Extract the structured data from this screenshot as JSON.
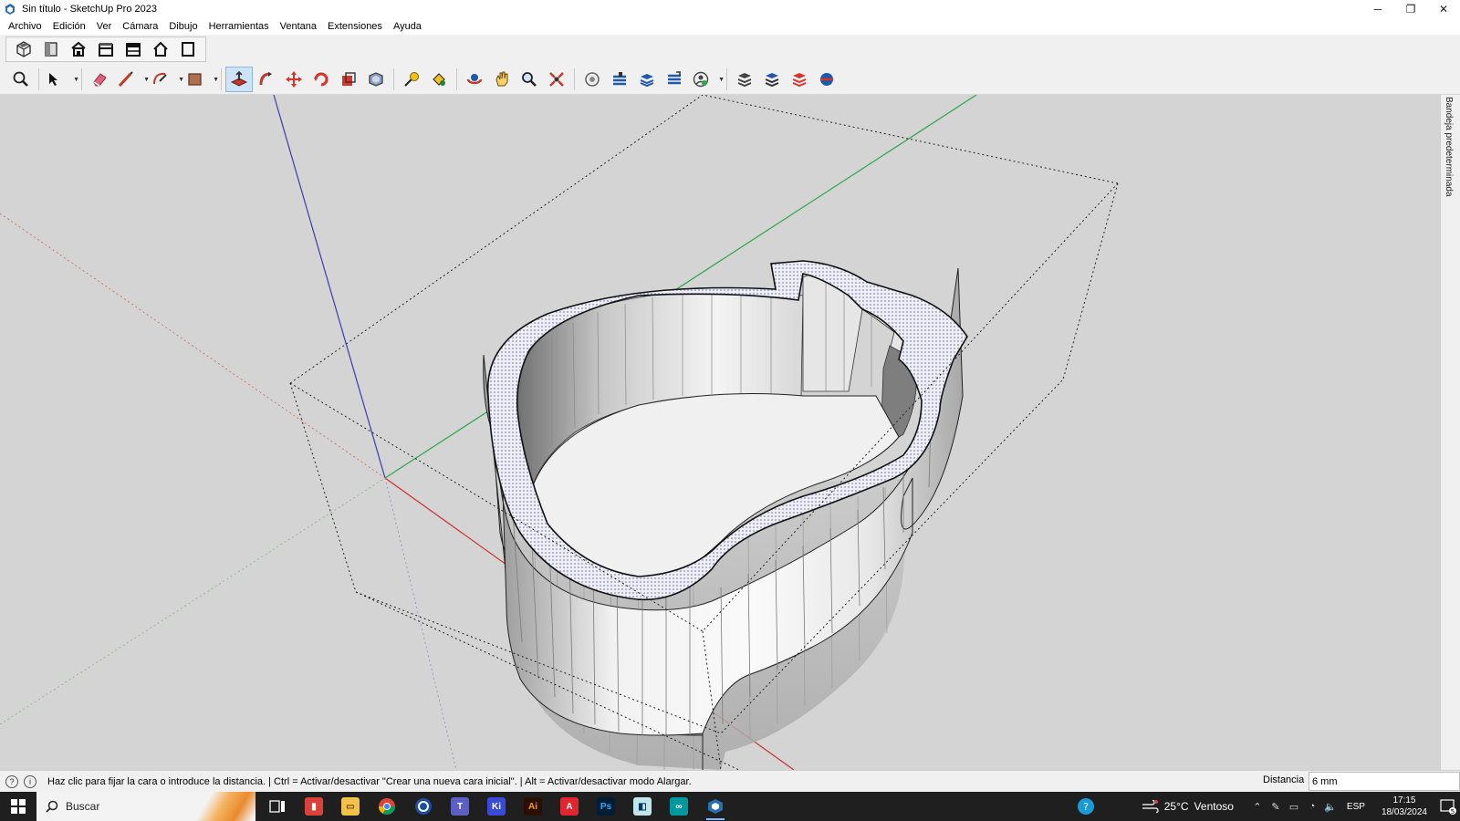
{
  "window": {
    "title": "Sin título - SketchUp Pro 2023",
    "controls": {
      "minimize": "─",
      "restore": "❐",
      "close": "✕"
    }
  },
  "menu": [
    "Archivo",
    "Edición",
    "Ver",
    "Cámara",
    "Dibujo",
    "Herramientas",
    "Ventana",
    "Extensiones",
    "Ayuda"
  ],
  "toolbar_views": [
    "iso-view-icon",
    "top-view-icon",
    "front-view-icon",
    "right-view-icon",
    "back-view-icon",
    "left-view-icon",
    "bottom-view-icon"
  ],
  "toolbar_main": {
    "active_tool": "push-pull-tool",
    "colors": {
      "active_bg": "#cde3f7",
      "eraser": "#e0607a",
      "pencil": "#c0392b",
      "rotate": "#d8342a",
      "move": "#d8342a",
      "scale": "#d8342a"
    }
  },
  "tray": {
    "label": "Bandeja predeterminada"
  },
  "status": {
    "message": "Haz clic para fijar la cara o introduce la distancia. | Ctrl = Activar/desactivar \"Crear una nueva cara inicial\". | Alt = Activar/desactivar modo Alargar.",
    "vcb_label": "Distancia",
    "vcb_value": "6 mm"
  },
  "viewport": {
    "background": "#d4d4d4",
    "axis_colors": {
      "red": "#d03030",
      "green": "#2fa64a",
      "blue": "#3a3ab8"
    }
  },
  "taskbar": {
    "search_placeholder": "Buscar",
    "apps": [
      {
        "name": "task-view",
        "label": ""
      },
      {
        "name": "app-red",
        "label": ""
      },
      {
        "name": "file-explorer",
        "label": ""
      },
      {
        "name": "chrome",
        "label": ""
      },
      {
        "name": "app-blue-circle",
        "label": ""
      },
      {
        "name": "teams",
        "label": ""
      },
      {
        "name": "kidlogger",
        "label": "Ki"
      },
      {
        "name": "illustrator",
        "label": "Ai"
      },
      {
        "name": "acrobat",
        "label": "A"
      },
      {
        "name": "photoshop",
        "label": "Ps"
      },
      {
        "name": "app-notes",
        "label": ""
      },
      {
        "name": "arduino",
        "label": "∞"
      },
      {
        "name": "sketchup",
        "label": ""
      }
    ],
    "weather": {
      "temp": "25°C",
      "condition": "Ventoso"
    },
    "language": "ESP",
    "time": "17:15",
    "date": "18/03/2024",
    "notification_count": "5"
  }
}
